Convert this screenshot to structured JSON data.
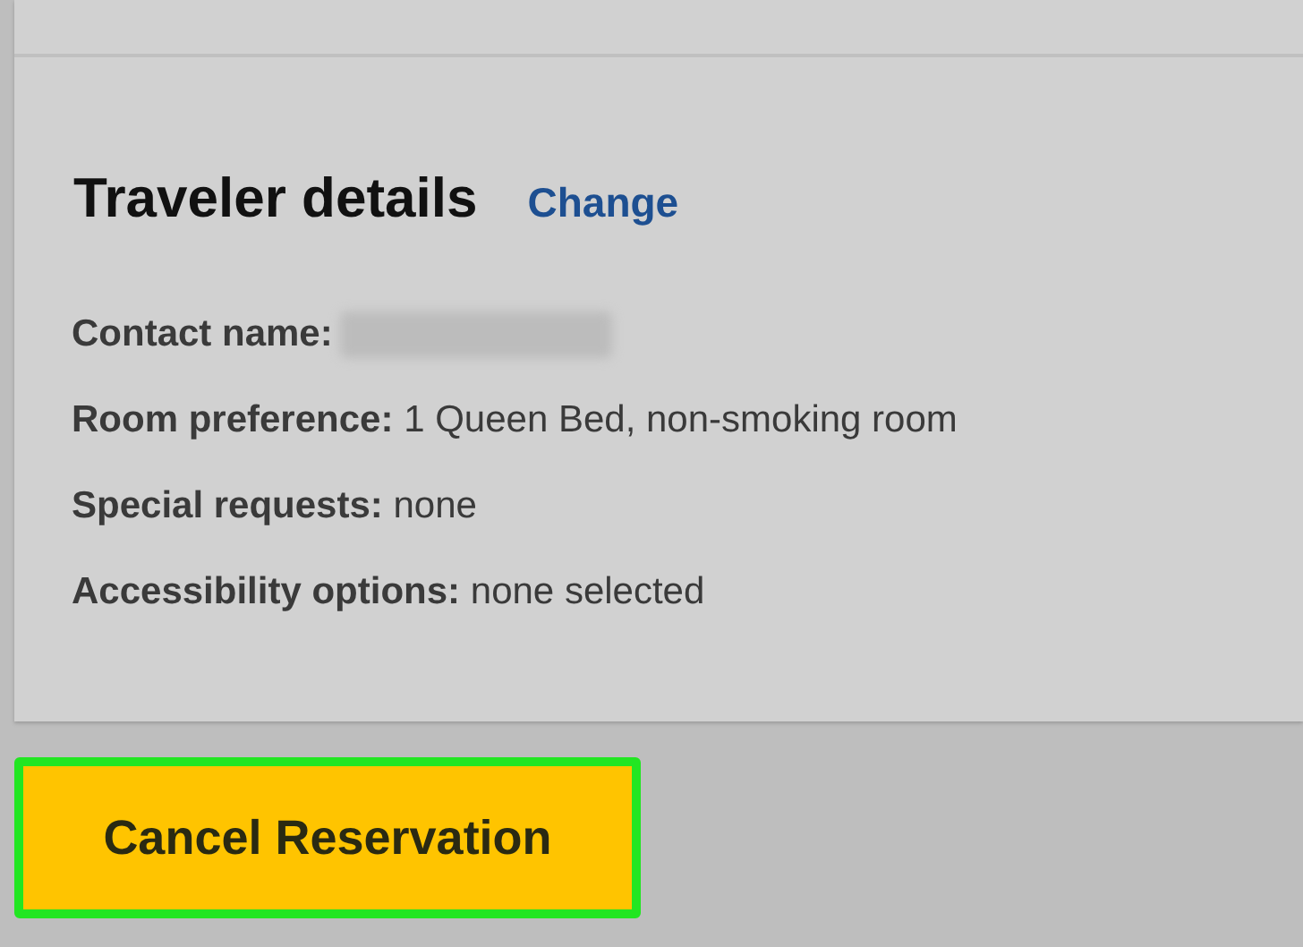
{
  "section": {
    "title": "Traveler details",
    "link": "Change"
  },
  "details": [
    {
      "kind": "blurred",
      "label": "Contact name:"
    },
    {
      "kind": "text",
      "label": "Room preference:",
      "value": "1 Queen Bed, non-smoking room"
    },
    {
      "kind": "text",
      "label": "Special requests:",
      "value": "none"
    },
    {
      "kind": "text",
      "label": "Accessibility options:",
      "value": "none selected"
    }
  ],
  "cancel_button": {
    "label": "Cancel Reservation",
    "highlighted": true
  }
}
